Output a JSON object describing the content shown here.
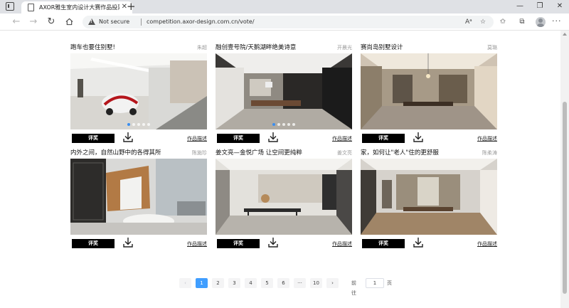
{
  "browser": {
    "tab_title": "AXOR雅生室内设计大赛作品投票",
    "tab_close": "✕",
    "new_tab": "+",
    "security_label": "Not secure",
    "url": "competition.axor-design.com.cn/vote/",
    "window_controls": [
      "—",
      "❐",
      "✕"
    ]
  },
  "entries": [
    {
      "title": "跑车也要住别墅!",
      "author": "朱超",
      "vote_label": "评奖",
      "desc_label": "作品描述",
      "carousel_dots": 5
    },
    {
      "title": "融创壹号院/天鹅湖畔绝美诗意",
      "author": "开晨光",
      "vote_label": "评奖",
      "desc_label": "作品描述",
      "carousel_dots": 5
    },
    {
      "title": "赛尚岛别墅设计",
      "author": "莫璐",
      "vote_label": "评奖",
      "desc_label": "作品描述",
      "carousel_dots": 0
    },
    {
      "title": "内外之间，自然山野中的各得其所",
      "author": "陈施珍",
      "vote_label": "评奖",
      "desc_label": "作品描述",
      "carousel_dots": 0
    },
    {
      "title": "姜文亮—金悦广场 让空间更纯粹",
      "author": "姜文亮",
      "vote_label": "评奖",
      "desc_label": "作品描述",
      "carousel_dots": 0
    },
    {
      "title": "家，如何让\"老人\"住的更舒服",
      "author": "陈柔涛",
      "vote_label": "评奖",
      "desc_label": "作品描述",
      "carousel_dots": 0
    }
  ],
  "pagination": {
    "prev": "‹",
    "pages": [
      "1",
      "2",
      "3",
      "4",
      "5",
      "6",
      "···",
      "10"
    ],
    "current": "1",
    "next": "›",
    "goto_prefix": "前往",
    "goto_value": "1",
    "goto_suffix": "页"
  },
  "colors": {
    "accent": "#409eff",
    "button": "#000000",
    "dot_active": "#3b8ef0"
  }
}
